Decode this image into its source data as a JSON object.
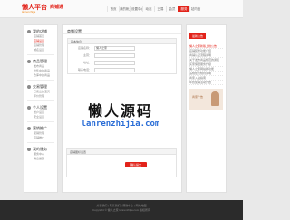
{
  "header": {
    "logo_main": "懒人平台",
    "logo_sub": "lanrenzhijia",
    "logo_right": "商铺通",
    "nav": [
      "首页",
      "我的帐户",
      "设置中心",
      "动态",
      "交易",
      "会员",
      "服务",
      "站内信"
    ],
    "active_nav_index": 6
  },
  "sidebar": {
    "groups": [
      {
        "title": "我的店铺",
        "items": [
          "店铺首页",
          "店铺设置",
          "店铺管理",
          "域名设置"
        ]
      },
      {
        "title": "商品管理",
        "items": [
          "发布商品",
          "出售中的商品",
          "仓库中的商品"
        ]
      },
      {
        "title": "交易管理",
        "items": [
          "已卖出的宝贝",
          "评价管理"
        ]
      },
      {
        "title": "个人设置",
        "items": [
          "帐户设置",
          "安全设置"
        ]
      },
      {
        "title": "营销推广",
        "items": [
          "促销管理",
          "店铺推广"
        ]
      },
      {
        "title": "我的服务",
        "items": [
          "服务中心",
          "消息提醒"
        ]
      }
    ]
  },
  "main": {
    "title": "商铺设置",
    "panel_title": "基本信息",
    "fields": [
      {
        "label": "店铺名称：",
        "value": "懒人之家"
      },
      {
        "label": "主营：",
        "value": ""
      },
      {
        "label": "地址：",
        "value": ""
      },
      {
        "label": "联系电话：",
        "value": ""
      }
    ],
    "panel2_title": "店铺图标设置",
    "submit_label": "确认提交"
  },
  "watermark": {
    "cn": "懒人源码",
    "url": "lanrenzhijia.com"
  },
  "right": {
    "tab": "最新公告",
    "items": [
      "懒人之家新版上线公告",
      "店铺装修功能介绍",
      "商铺认证流程说明",
      "关于发布商品规范的通知",
      "买家保障服务升级",
      "懒人之家网站新功能",
      "违规处罚规则说明",
      "商家入驻指南",
      "年终促销活动开启"
    ],
    "ad_text": "商家广告"
  },
  "footer": {
    "lines": [
      "关于我们 | 联系我们 | 帮助中心 | 网站地图",
      "Copyright © 懒人之家 lanrenzhijia.com 版权所有"
    ]
  },
  "colors": {
    "brand": "#e2231a",
    "footer": "#2b2b2b"
  }
}
